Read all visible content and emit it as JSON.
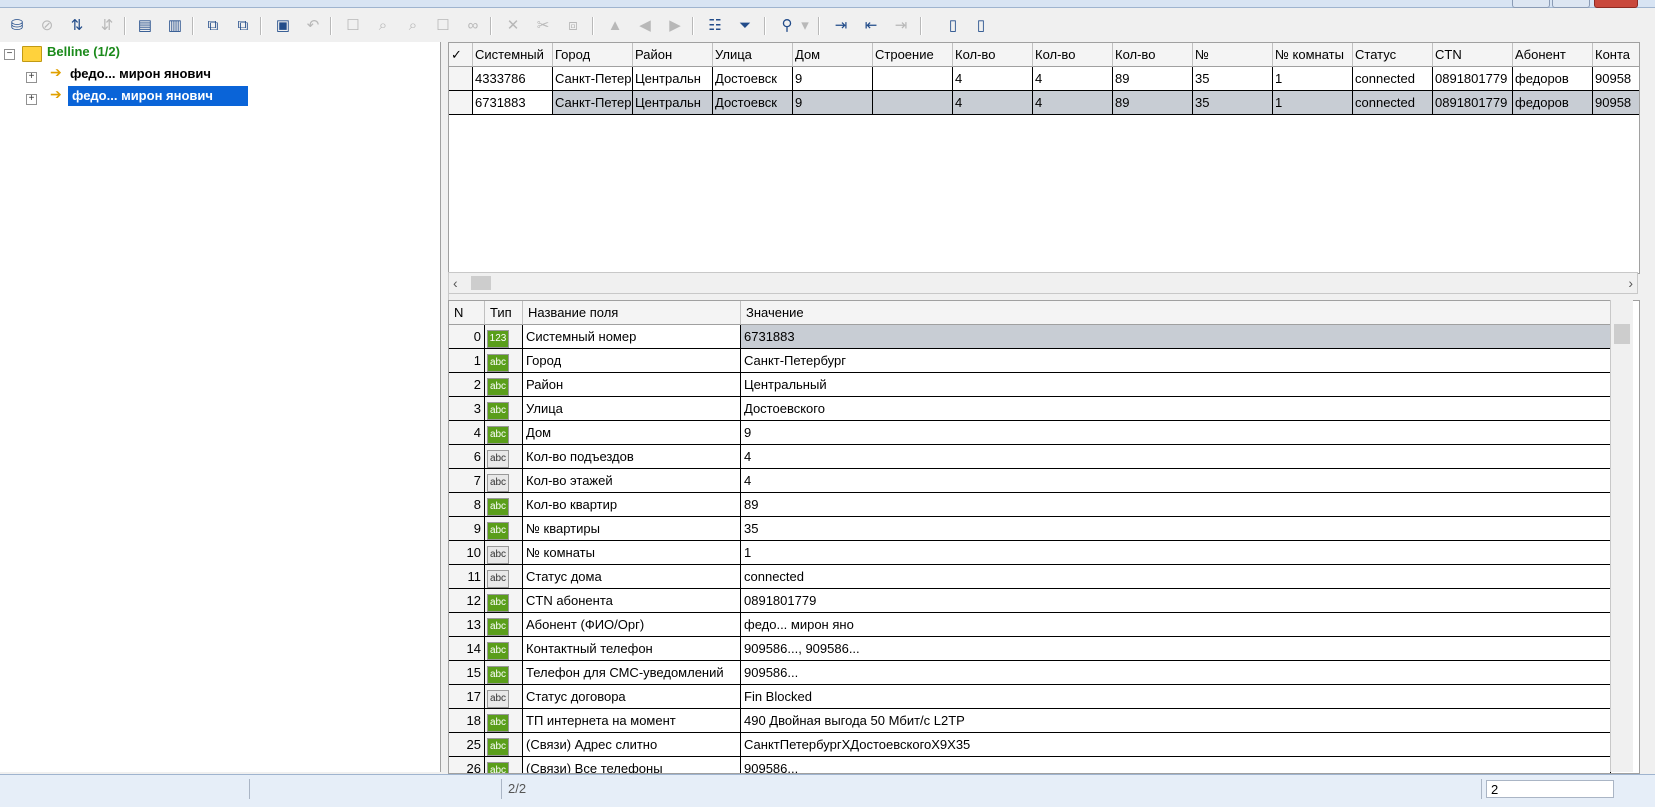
{
  "tree": {
    "root_label": "Belline (1/2)",
    "nodes": [
      {
        "label": "федо... мирон янович",
        "selected": false
      },
      {
        "label": "федо... мирон янович",
        "selected": true
      }
    ]
  },
  "top_grid": {
    "columns": [
      "Системный",
      "Город",
      "Район",
      "Улица",
      "Дом",
      "Строение",
      "Кол-во",
      "Кол-во",
      "Кол-во",
      "№",
      "№ комнаты",
      "Статус",
      "CTN",
      "Абонент",
      "Конта"
    ],
    "rows": [
      [
        "4333786",
        "Санкт-Петер",
        "Центральн",
        "Достоевск",
        "9",
        "",
        "4",
        "4",
        "89",
        "35",
        "1",
        "connected",
        "0891801779",
        "федоров",
        "90958"
      ],
      [
        "6731883",
        "Санкт-Петер",
        "Центральн",
        "Достоевск",
        "9",
        "",
        "4",
        "4",
        "89",
        "35",
        "1",
        "connected",
        "0891801779",
        "федоров",
        "90958"
      ]
    ]
  },
  "bottom_grid": {
    "columns": [
      "N",
      "Тип",
      "Название поля",
      "Значение"
    ],
    "rows": [
      {
        "n": "0",
        "type": "123",
        "name": "Системный номер",
        "value": "6731883"
      },
      {
        "n": "1",
        "type": "abc",
        "name": "Город",
        "value": "Санкт-Петербург"
      },
      {
        "n": "2",
        "type": "abc",
        "name": "Район",
        "value": "Центральный"
      },
      {
        "n": "3",
        "type": "abc",
        "name": "Улица",
        "value": "Достоевского"
      },
      {
        "n": "4",
        "type": "abc",
        "name": "Дом",
        "value": "9"
      },
      {
        "n": "6",
        "type": "abc",
        "name": "Кол-во подъездов",
        "value": "4"
      },
      {
        "n": "7",
        "type": "abc",
        "name": "Кол-во этажей",
        "value": "4"
      },
      {
        "n": "8",
        "type": "abc",
        "name": "Кол-во квартир",
        "value": "89"
      },
      {
        "n": "9",
        "type": "abc",
        "name": "№ квартиры",
        "value": "35"
      },
      {
        "n": "10",
        "type": "abc",
        "name": "№ комнаты",
        "value": "1"
      },
      {
        "n": "11",
        "type": "abc",
        "name": "Статус дома",
        "value": "connected"
      },
      {
        "n": "12",
        "type": "abc",
        "name": "CTN абонента",
        "value": "0891801779"
      },
      {
        "n": "13",
        "type": "abc",
        "name": "Абонент (ФИО/Орг)",
        "value": "федо... мирон яно"
      },
      {
        "n": "14",
        "type": "abc",
        "name": "Контактный телефон",
        "value": "909586..., 909586..."
      },
      {
        "n": "15",
        "type": "abc",
        "name": "Телефон для СМС-уведомлений",
        "value": "909586..."
      },
      {
        "n": "17",
        "type": "abc",
        "name": "Статус договора",
        "value": "Fin Blocked"
      },
      {
        "n": "18",
        "type": "abc",
        "name": "ТП интернета на момент",
        "value": "490 Двойная выгода 50 Мбит/с L2TP"
      },
      {
        "n": "25",
        "type": "abc",
        "name": "(Связи) Адрес слитно",
        "value": "СанктПетербургXДостоевскогоX9X35"
      },
      {
        "n": "26",
        "type": "abc",
        "name": "(Связи) Все телефоны",
        "value": "909586..."
      }
    ]
  },
  "status": {
    "count": "2/2",
    "value": "2"
  },
  "colors": {
    "tree_root": "#1a8a1a",
    "selection": "#0a64d8",
    "type_green": "#5a9e1a",
    "type_gray": "#e8e8e8"
  }
}
